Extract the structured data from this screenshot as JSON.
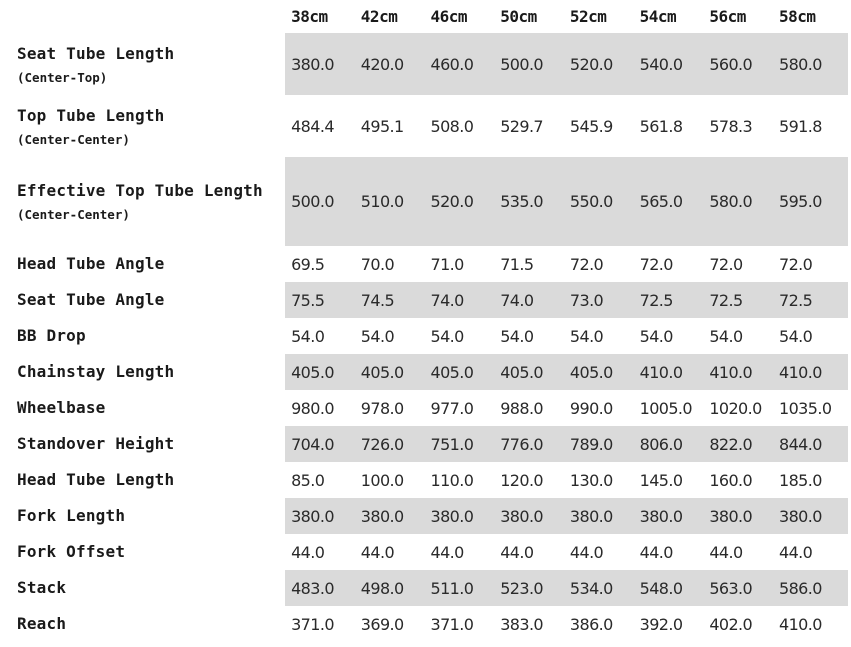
{
  "sizes": [
    "38cm",
    "42cm",
    "46cm",
    "50cm",
    "52cm",
    "54cm",
    "56cm",
    "58cm"
  ],
  "rows": [
    {
      "label": "Seat Tube Length",
      "sub": "(Center-Top)",
      "values": [
        "380.0",
        "420.0",
        "460.0",
        "500.0",
        "520.0",
        "540.0",
        "560.0",
        "580.0"
      ]
    },
    {
      "label": "Top Tube Length",
      "sub": "(Center-Center)",
      "values": [
        "484.4",
        "495.1",
        "508.0",
        "529.7",
        "545.9",
        "561.8",
        "578.3",
        "591.8"
      ]
    },
    {
      "label": "Effective Top Tube Length",
      "sub": "(Center-Center)",
      "values": [
        "500.0",
        "510.0",
        "520.0",
        "535.0",
        "550.0",
        "565.0",
        "580.0",
        "595.0"
      ]
    },
    {
      "label": "Head Tube Angle",
      "sub": "",
      "values": [
        "69.5",
        "70.0",
        "71.0",
        "71.5",
        "72.0",
        "72.0",
        "72.0",
        "72.0"
      ]
    },
    {
      "label": "Seat Tube Angle",
      "sub": "",
      "values": [
        "75.5",
        "74.5",
        "74.0",
        "74.0",
        "73.0",
        "72.5",
        "72.5",
        "72.5"
      ]
    },
    {
      "label": "BB Drop",
      "sub": "",
      "values": [
        "54.0",
        "54.0",
        "54.0",
        "54.0",
        "54.0",
        "54.0",
        "54.0",
        "54.0"
      ]
    },
    {
      "label": "Chainstay Length",
      "sub": "",
      "values": [
        "405.0",
        "405.0",
        "405.0",
        "405.0",
        "405.0",
        "410.0",
        "410.0",
        "410.0"
      ]
    },
    {
      "label": "Wheelbase",
      "sub": "",
      "values": [
        "980.0",
        "978.0",
        "977.0",
        "988.0",
        "990.0",
        "1005.0",
        "1020.0",
        "1035.0"
      ]
    },
    {
      "label": "Standover Height",
      "sub": "",
      "values": [
        "704.0",
        "726.0",
        "751.0",
        "776.0",
        "789.0",
        "806.0",
        "822.0",
        "844.0"
      ]
    },
    {
      "label": "Head Tube Length",
      "sub": "",
      "values": [
        "85.0",
        "100.0",
        "110.0",
        "120.0",
        "130.0",
        "145.0",
        "160.0",
        "185.0"
      ]
    },
    {
      "label": "Fork Length",
      "sub": "",
      "values": [
        "380.0",
        "380.0",
        "380.0",
        "380.0",
        "380.0",
        "380.0",
        "380.0",
        "380.0"
      ]
    },
    {
      "label": "Fork Offset",
      "sub": "",
      "values": [
        "44.0",
        "44.0",
        "44.0",
        "44.0",
        "44.0",
        "44.0",
        "44.0",
        "44.0"
      ]
    },
    {
      "label": "Stack",
      "sub": "",
      "values": [
        "483.0",
        "498.0",
        "511.0",
        "523.0",
        "534.0",
        "548.0",
        "563.0",
        "586.0"
      ]
    },
    {
      "label": "Reach",
      "sub": "",
      "values": [
        "371.0",
        "369.0",
        "371.0",
        "383.0",
        "386.0",
        "392.0",
        "402.0",
        "410.0"
      ]
    }
  ]
}
